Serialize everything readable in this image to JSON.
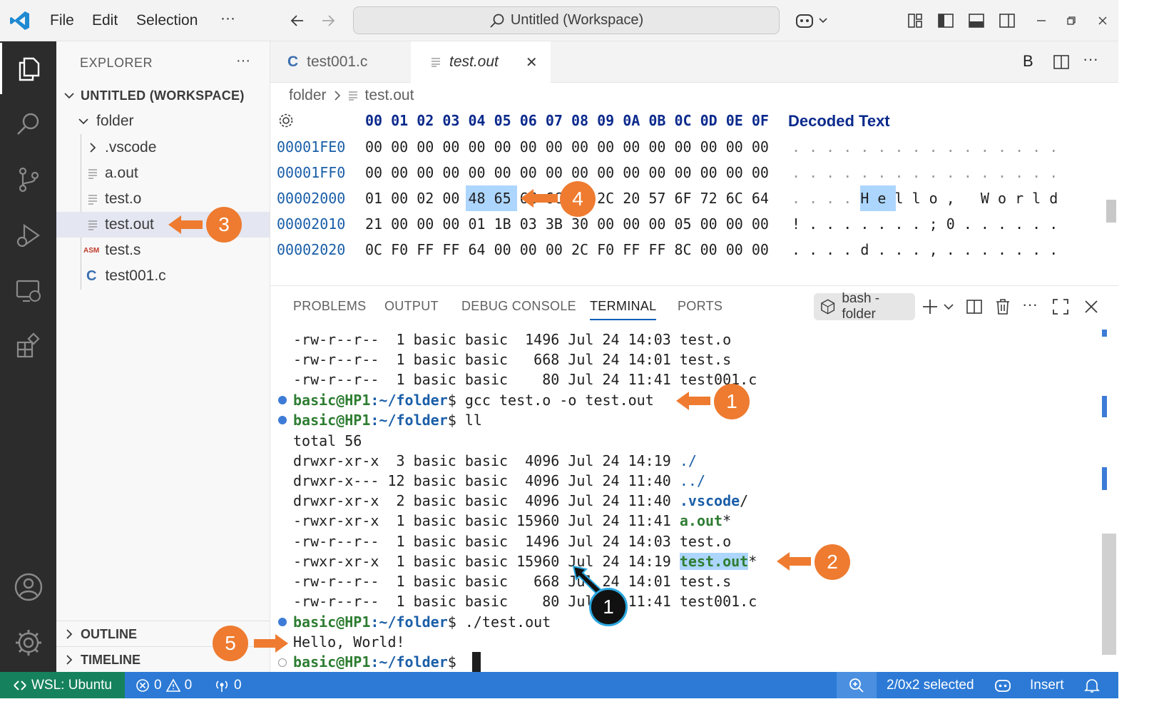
{
  "titlebar": {
    "menus": [
      "File",
      "Edit",
      "Selection",
      "···"
    ],
    "search_text": "Untitled (Workspace)"
  },
  "sidebar": {
    "title": "EXPLORER",
    "more": "···",
    "workspace": "UNTITLED (WORKSPACE)",
    "items": [
      {
        "label": "folder",
        "icon": "chevron-down-icon"
      },
      {
        "label": ".vscode",
        "icon": "chevron-right-icon"
      },
      {
        "label": "a.out",
        "icon": "file-lines-icon"
      },
      {
        "label": "test.o",
        "icon": "file-lines-icon"
      },
      {
        "label": "test.out",
        "icon": "file-lines-icon"
      },
      {
        "label": "test.s",
        "icon": "asm-icon"
      },
      {
        "label": "test001.c",
        "icon": "c-icon"
      }
    ],
    "asm_badge": "ASM",
    "c_badge": "C",
    "outline": "OUTLINE",
    "timeline": "TIMELINE"
  },
  "tabs": [
    {
      "label": "test001.c",
      "icon_text": "C"
    },
    {
      "label": "test.out",
      "close": "✕"
    }
  ],
  "editor_actions": {
    "b": "B",
    "more": "···"
  },
  "breadcrumb": {
    "folder": "folder",
    "file": "test.out"
  },
  "hex": {
    "header": "00 01 02 03 04 05 06 07 08 09 0A 0B 0C 0D 0E 0F",
    "decoded_header": "Decoded Text",
    "rows": [
      {
        "addr": "00001FE0",
        "bytes": "00 00 00 00 00 00 00 00 00 00 00 00 00 00 00 00",
        "text": ". . . . . . . . . . . . . . . ."
      },
      {
        "addr": "00001FF0",
        "bytes": "00 00 00 00 00 00 00 00 00 00 00 00 00 00 00 00",
        "text": ". . . . . . . . . . . . . . . ."
      },
      {
        "addr": "00002000",
        "bytes_a": "01 00 02 00",
        "bytes_sel": "48 65",
        "bytes_b": "6C 6C 6F 2C 20 57 6F 72 6C 64",
        "text_a": ". . . . ",
        "text_sel": "H e",
        "text_b": " l l o ,   W o r l d"
      },
      {
        "addr": "00002010",
        "bytes": "21 00 00 00 01 1B 03 3B 30 00 00 00 05 00 00 00",
        "text": "! . . . . . . . ; 0 . . . . . ."
      },
      {
        "addr": "00002020",
        "bytes": "0C F0 FF FF 64 00 00 00 2C F0 FF FF 8C 00 00 00",
        "text": ". . . . d . . . , . . . . . . ."
      }
    ]
  },
  "panel": {
    "tabs": [
      "PROBLEMS",
      "OUTPUT",
      "DEBUG CONSOLE",
      "TERMINAL",
      "PORTS"
    ],
    "terminal_name": "bash - folder",
    "more": "···"
  },
  "terminal": {
    "user": "basic@HP1",
    "path": ":~/folder",
    "dollar": "$",
    "pre_lines": [
      {
        "perm": "-rw-r--r--  1 basic basic  1496 Jul 24 14:03 ",
        "name": "test.o"
      },
      {
        "perm": "-rw-r--r--  1 basic basic   668 Jul 24 14:01 ",
        "name": "test.s"
      },
      {
        "perm": "-rw-r--r--  1 basic basic    80 Jul 24 11:41 ",
        "name": "test001.c"
      }
    ],
    "cmd1": " gcc test.o -o test.out",
    "cmd2": " ll",
    "total": "total 56",
    "ls_lines": [
      {
        "perm": "drwxr-xr-x  3 basic basic  4096 Jul 24 14:19 ",
        "name": "./",
        "kind": "dir",
        "suffix": ""
      },
      {
        "perm": "drwxr-x--- 12 basic basic  4096 Jul 24 11:40 ",
        "name": "../",
        "kind": "dir",
        "suffix": ""
      },
      {
        "perm": "drwxr-xr-x  2 basic basic  4096 Jul 24 11:40 ",
        "name": ".vscode",
        "kind": "dir",
        "suffix": "/"
      },
      {
        "perm": "-rwxr-xr-x  1 basic basic 15960 Jul 24 11:41 ",
        "name": "a.out",
        "kind": "exec",
        "suffix": "*"
      },
      {
        "perm": "-rw-r--r--  1 basic basic  1496 Jul 24 14:03 ",
        "name": "test.o",
        "kind": "plain",
        "suffix": ""
      },
      {
        "perm": "-rwxr-xr-x  1 basic basic 15960 Jul 24 14:19 ",
        "name": "test.out",
        "kind": "exec-sel",
        "suffix": "*"
      },
      {
        "perm": "-rw-r--r--  1 basic basic   668 Jul 24 14:01 ",
        "name": "test.s",
        "kind": "plain",
        "suffix": ""
      },
      {
        "perm": "-rw-r--r--  1 basic basic    80 Jul 24 11:41 ",
        "name": "test001.c",
        "kind": "plain",
        "suffix": ""
      }
    ],
    "cmd3": " ./test.out",
    "output": "Hello, World!"
  },
  "callouts": [
    "1",
    "2",
    "3",
    "4",
    "5",
    "1"
  ],
  "statusbar": {
    "remote": "WSL: Ubuntu",
    "errors": "0",
    "warnings": "0",
    "ports": "0",
    "selection": "2/0x2 selected",
    "mode": "Insert"
  },
  "colors": {
    "accent": "#2c7ad6",
    "activity_bg": "#2c2c2c",
    "callout": "#ee7b30",
    "prompt_user": "#2e7d32",
    "prompt_path": "#1a5ea8"
  }
}
